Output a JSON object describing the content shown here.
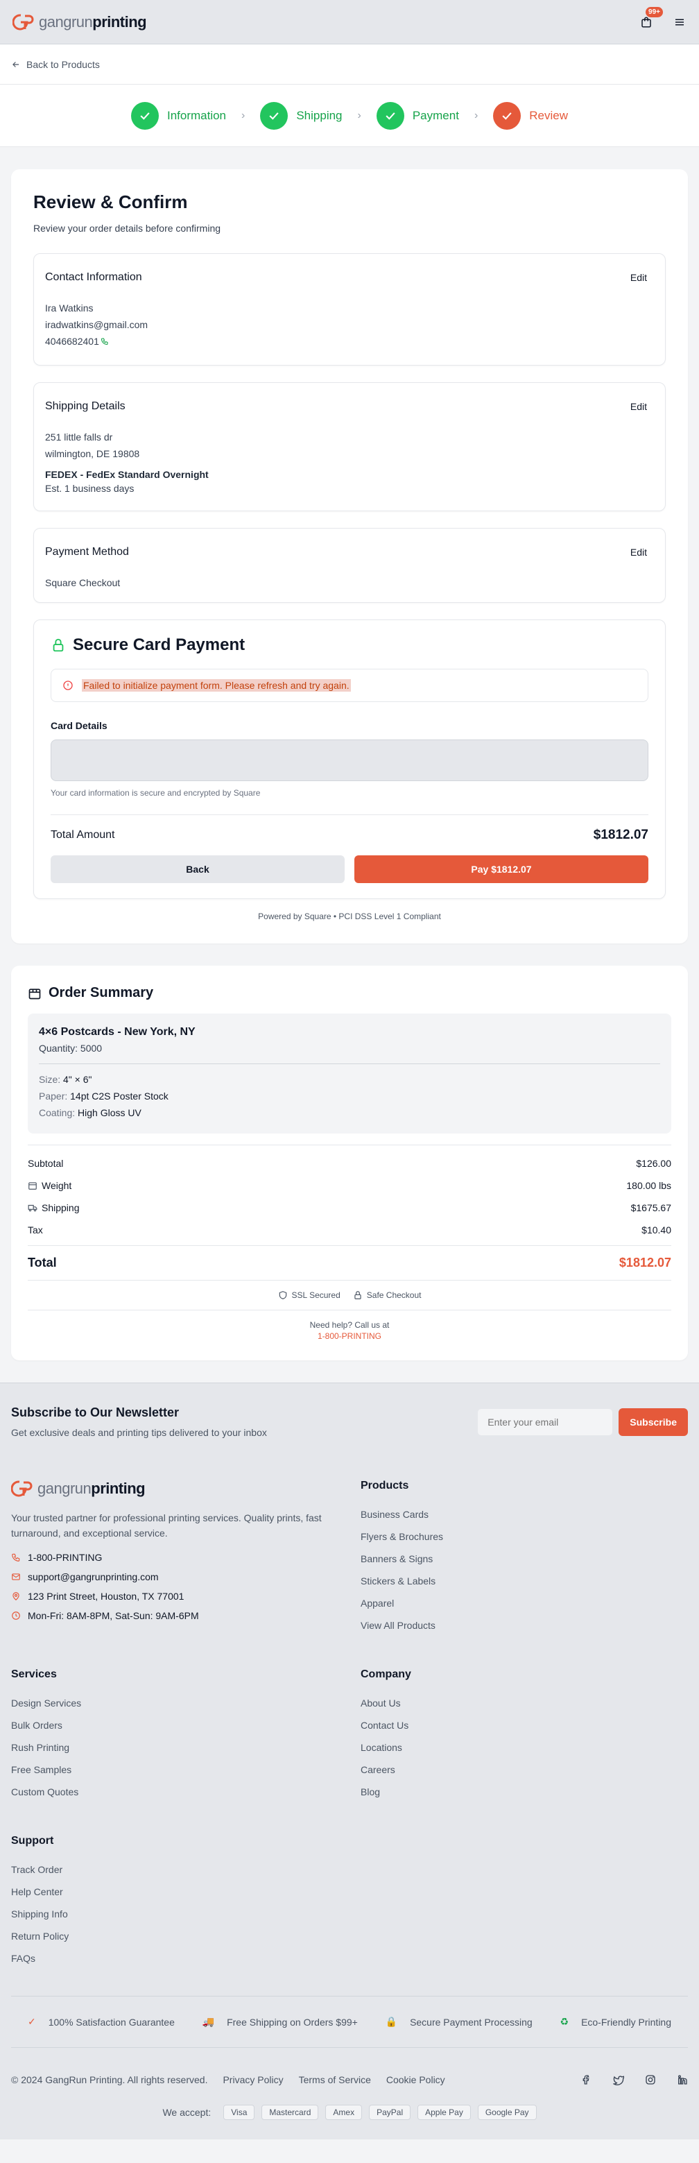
{
  "header": {
    "logo_light": "gangrun",
    "logo_bold": "printing",
    "cart_badge": "99+",
    "back_label": "Back to Products"
  },
  "steps": [
    {
      "label": "Information",
      "state": "done"
    },
    {
      "label": "Shipping",
      "state": "done"
    },
    {
      "label": "Payment",
      "state": "done"
    },
    {
      "label": "Review",
      "state": "active"
    }
  ],
  "review": {
    "title": "Review & Confirm",
    "subtitle": "Review your order details before confirming",
    "edit_label": "Edit",
    "contact": {
      "title": "Contact Information",
      "name": "Ira Watkins",
      "email": "iradwatkins@gmail.com",
      "phone": "4046682401"
    },
    "shipping": {
      "title": "Shipping Details",
      "address1": "251 little falls dr",
      "address2": "wilmington, DE 19808",
      "method": "FEDEX - FedEx Standard Overnight",
      "eta": "Est. 1 business days"
    },
    "payment": {
      "title": "Payment Method",
      "method": "Square Checkout"
    },
    "secure": {
      "title": "Secure Card Payment",
      "error": "Failed to initialize payment form. Please refresh and try again.",
      "card_label": "Card Details",
      "hint": "Your card information is secure and encrypted by Square",
      "total_label": "Total Amount",
      "total_value": "$1812.07",
      "back_button": "Back",
      "pay_button": "Pay $1812.07"
    },
    "powered": "Powered by Square • PCI DSS Level 1 Compliant"
  },
  "summary": {
    "title": "Order Summary",
    "product_name": "4×6 Postcards - New York, NY",
    "quantity": "Quantity: 5000",
    "specs": [
      {
        "key": "Size:",
        "value": "4\" × 6\""
      },
      {
        "key": "Paper:",
        "value": "14pt C2S Poster Stock"
      },
      {
        "key": "Coating:",
        "value": "High Gloss UV"
      }
    ],
    "subtotal_label": "Subtotal",
    "subtotal_value": "$126.00",
    "weight_label": "Weight",
    "weight_value": "180.00 lbs",
    "shipping_label": "Shipping",
    "shipping_value": "$1675.67",
    "tax_label": "Tax",
    "tax_value": "$10.40",
    "total_label": "Total",
    "total_value": "$1812.07",
    "ssl": "SSL Secured",
    "safe": "Safe Checkout",
    "help": "Need help? Call us at",
    "help_phone": "1-800-PRINTING"
  },
  "newsletter": {
    "title": "Subscribe to Our Newsletter",
    "subtitle": "Get exclusive deals and printing tips delivered to your inbox",
    "placeholder": "Enter your email",
    "button": "Subscribe"
  },
  "footer": {
    "description": "Your trusted partner for professional printing services. Quality prints, fast turnaround, and exceptional service.",
    "phone": "1-800-PRINTING",
    "email": "support@gangrunprinting.com",
    "address": "123 Print Street, Houston, TX 77001",
    "hours": "Mon-Fri: 8AM-8PM, Sat-Sun: 9AM-6PM",
    "products": {
      "title": "Products",
      "links": [
        "Business Cards",
        "Flyers & Brochures",
        "Banners & Signs",
        "Stickers & Labels",
        "Apparel",
        "View All Products"
      ]
    },
    "services": {
      "title": "Services",
      "links": [
        "Design Services",
        "Bulk Orders",
        "Rush Printing",
        "Free Samples",
        "Custom Quotes"
      ]
    },
    "company": {
      "title": "Company",
      "links": [
        "About Us",
        "Contact Us",
        "Locations",
        "Careers",
        "Blog"
      ]
    },
    "support": {
      "title": "Support",
      "links": [
        "Track Order",
        "Help Center",
        "Shipping Info",
        "Return Policy",
        "FAQs"
      ]
    },
    "features": [
      "100% Satisfaction Guarantee",
      "Free Shipping on Orders $99+",
      "Secure Payment Processing",
      "Eco-Friendly Printing"
    ],
    "copyright": "© 2024 GangRun Printing. All rights reserved.",
    "legal": [
      "Privacy Policy",
      "Terms of Service",
      "Cookie Policy"
    ],
    "we_accept": "We accept:",
    "payment_methods": [
      "Visa",
      "Mastercard",
      "Amex",
      "PayPal",
      "Apple Pay",
      "Google Pay"
    ]
  },
  "colors": {
    "accent": "#e5593a",
    "success": "#22c55e"
  }
}
